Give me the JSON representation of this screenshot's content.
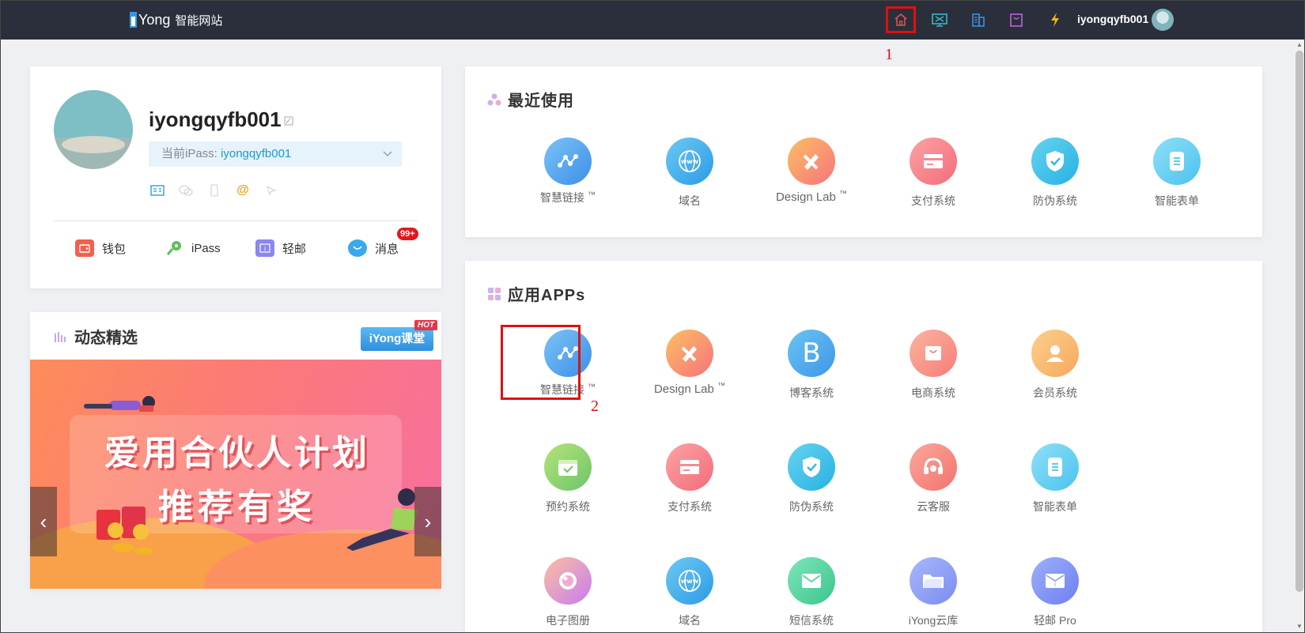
{
  "topbar": {
    "logo_brand": "Yong",
    "logo_sub": "智能网站",
    "username": "iyongqyfb001",
    "annotation_1": "1"
  },
  "profile": {
    "username": "iyongqyfb001",
    "ipass_label": "当前iPass: ",
    "ipass_value": "iyongqyfb001",
    "quick_links": {
      "wallet": "钱包",
      "ipass": "iPass",
      "mail": "轻邮",
      "messages": "消息",
      "messages_badge": "99+"
    }
  },
  "news": {
    "title": "动态精选",
    "course_button": "iYong课堂",
    "hot_tag": "HOT",
    "banner_line1": "爱用合伙人计划",
    "banner_line2": "推荐有奖",
    "prev_arrow": "‹",
    "next_arrow": "›"
  },
  "recent": {
    "title": "最近使用",
    "items": [
      {
        "label": "智慧链接",
        "tm": "™"
      },
      {
        "label": "域名"
      },
      {
        "label": "Design Lab",
        "tm": "™"
      },
      {
        "label": "支付系统"
      },
      {
        "label": "防伪系统"
      },
      {
        "label": "智能表单"
      }
    ]
  },
  "apps": {
    "title": "应用APPs",
    "annotation_2": "2",
    "items": [
      {
        "label": "智慧链接",
        "tm": "™"
      },
      {
        "label": "Design Lab",
        "tm": "™"
      },
      {
        "label": "博客系统"
      },
      {
        "label": "电商系统"
      },
      {
        "label": "会员系统"
      },
      {
        "label": "预约系统"
      },
      {
        "label": "支付系统"
      },
      {
        "label": "防伪系统"
      },
      {
        "label": "云客服"
      },
      {
        "label": "智能表单"
      },
      {
        "label": "电子图册"
      },
      {
        "label": "域名"
      },
      {
        "label": "短信系统"
      },
      {
        "label": "iYong云库"
      },
      {
        "label": "轻邮 Pro"
      }
    ]
  },
  "colors": {
    "topbar_bg": "#2b2f3b",
    "highlight": "#e01010",
    "accent_blue": "#1a9ad6"
  }
}
